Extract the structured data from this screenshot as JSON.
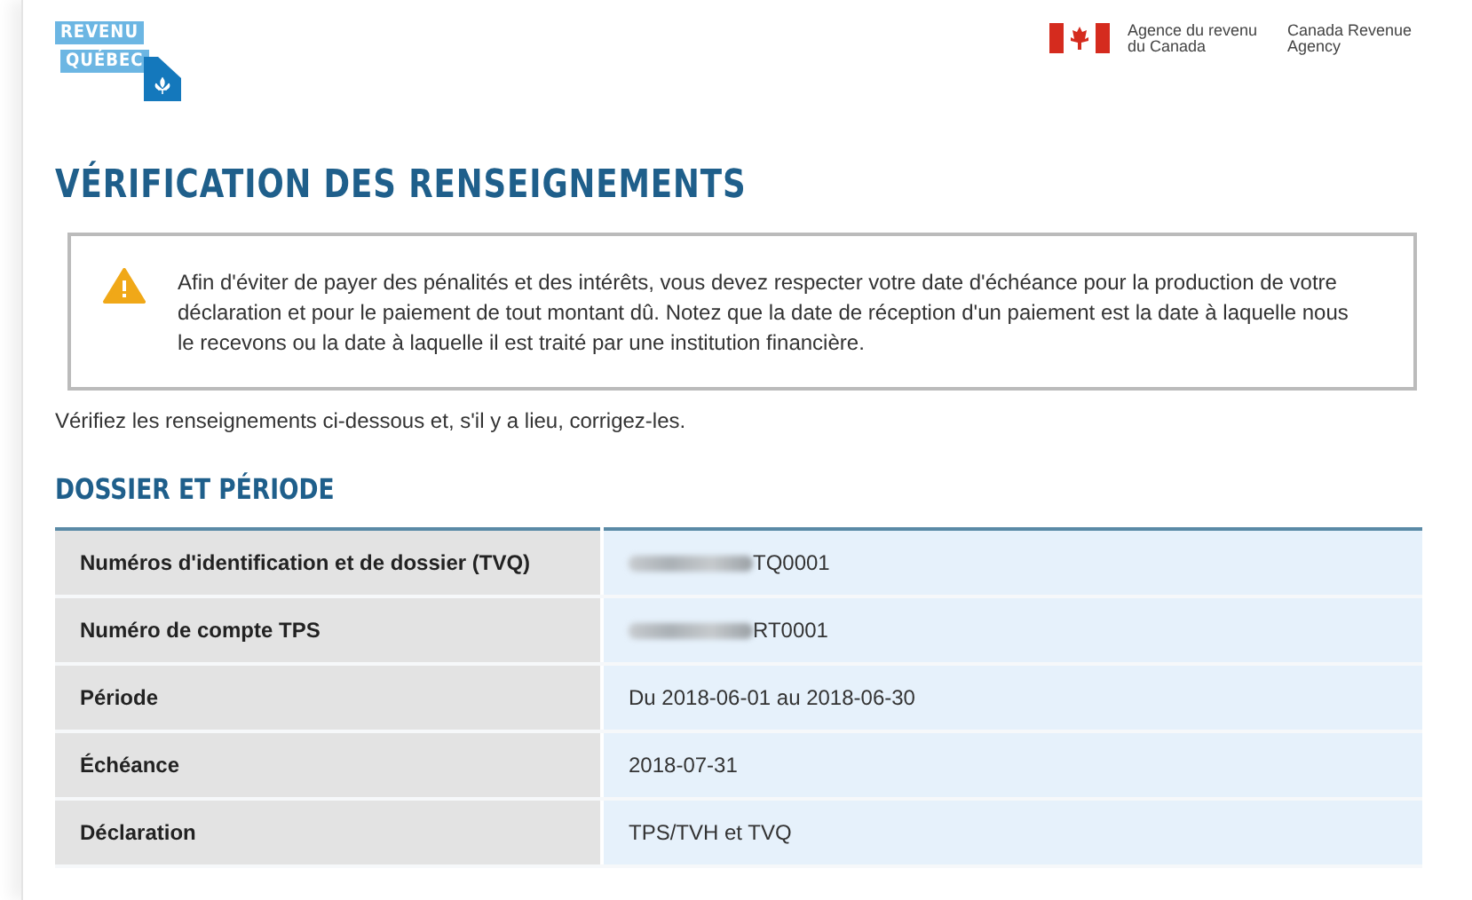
{
  "header": {
    "logo": {
      "line_1": "REVENU",
      "line_2": "QUÉBEC"
    },
    "federal": {
      "fr": "Agence du revenu du Canada",
      "en": "Canada Revenue Agency"
    }
  },
  "title": "VÉRIFICATION DES RENSEIGNEMENTS",
  "alert": {
    "text": "Afin d'éviter de payer des pénalités et des intérêts, vous devez respecter votre date d'échéance pour la production de votre déclaration et pour le paiement de tout montant dû. Notez que la date de réception d'un paiement est la date à laquelle nous le recevons ou la date à laquelle il est traité par une institution financière."
  },
  "instruction": "Vérifiez les renseignements ci-dessous et, s'il y a lieu, corrigez-les.",
  "section": {
    "heading": "DOSSIER ET PÉRIODE",
    "rows": [
      {
        "label": "Numéros d'identification et de dossier (TVQ)",
        "value": "TQ0001",
        "redacted": true
      },
      {
        "label": "Numéro de compte TPS",
        "value": "RT0001",
        "redacted": true
      },
      {
        "label": "Période",
        "value": "Du 2018-06-01 au 2018-06-30",
        "redacted": false
      },
      {
        "label": "Échéance",
        "value": "2018-07-31",
        "redacted": false
      },
      {
        "label": "Déclaration",
        "value": "TPS/TVH et TVQ",
        "redacted": false
      }
    ]
  }
}
